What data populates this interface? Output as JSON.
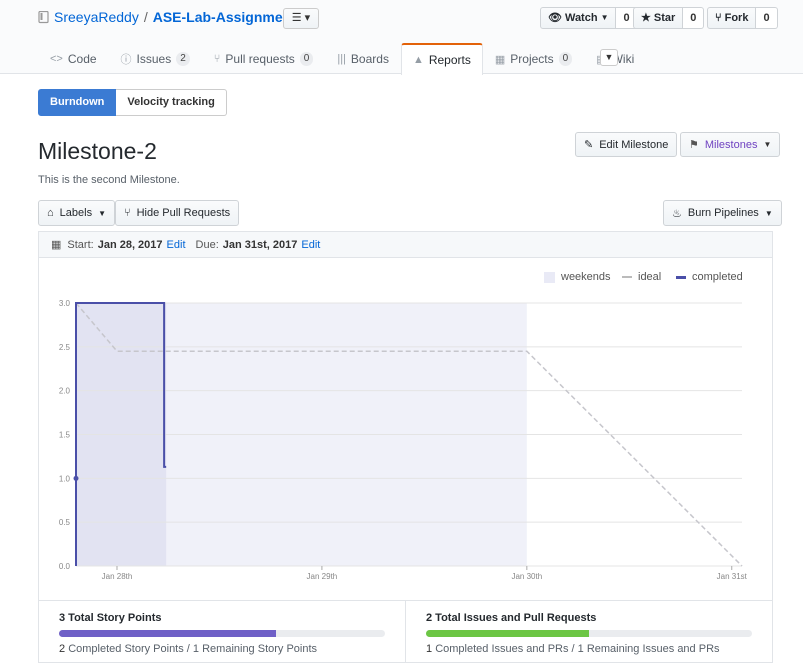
{
  "repo": {
    "owner": "SreeyaReddy",
    "separator": "/",
    "name": "ASE-Lab-Assignments"
  },
  "social": {
    "watch": {
      "label": "Watch",
      "count": "0"
    },
    "star": {
      "label": "Star",
      "count": "0"
    },
    "fork": {
      "label": "Fork",
      "count": "0"
    }
  },
  "tabs": [
    {
      "label": "Code",
      "count": ""
    },
    {
      "label": "Issues",
      "count": "2"
    },
    {
      "label": "Pull requests",
      "count": "0"
    },
    {
      "label": "Boards",
      "count": ""
    },
    {
      "label": "Reports",
      "count": ""
    },
    {
      "label": "Projects",
      "count": "0"
    },
    {
      "label": "Wiki",
      "count": ""
    }
  ],
  "report_tabs": {
    "burndown": "Burndown",
    "velocity": "Velocity tracking"
  },
  "milestone": {
    "title": "Milestone-2",
    "description": "This is the second Milestone."
  },
  "buttons": {
    "edit_milestone": "Edit Milestone",
    "milestones": "Milestones",
    "labels": "Labels",
    "hide_prs": "Hide Pull Requests",
    "burn_pipelines": "Burn Pipelines"
  },
  "dates": {
    "start_label": "Start:",
    "start": "Jan 28, 2017",
    "edit": "Edit",
    "due_label": "Due:",
    "due": "Jan 31st, 2017"
  },
  "chart_data": {
    "type": "line",
    "legend": [
      "weekends",
      "ideal",
      "completed"
    ],
    "legend_position": "top-right",
    "x_ticks": [
      "Jan 28th",
      "Jan 29th",
      "Jan 30th",
      "Jan 31st"
    ],
    "y_ticks": [
      "0.0",
      "0.5",
      "1.0",
      "1.5",
      "2.0",
      "2.5",
      "3.0"
    ],
    "ylim": [
      0,
      3
    ],
    "xlim": [
      -0.2,
      3.05
    ],
    "grid": true,
    "weekend_range": [
      -0.2,
      2.0
    ],
    "ideal": {
      "name": "ideal",
      "x": [
        -0.2,
        0.0,
        2.0,
        3.05
      ],
      "y": [
        3.0,
        2.45,
        2.45,
        0.0
      ]
    },
    "completed": {
      "name": "completed",
      "x": [
        -0.2,
        -0.2,
        0.23,
        0.23,
        0.24
      ],
      "y": [
        0.0,
        3.0,
        3.0,
        1.13,
        1.13
      ]
    },
    "completed_marker": {
      "x": -0.2,
      "y": 1.0
    },
    "highlight_range": [
      -0.2,
      0.24
    ]
  },
  "stats": {
    "points": {
      "title": "3 Total Story Points",
      "done": "2",
      "done_text": "Completed Story Points",
      "sep": " / ",
      "remaining": "1 Remaining Story Points",
      "fraction": 0.667,
      "color": "#6f60c7"
    },
    "issues": {
      "title": "2 Total Issues and Pull Requests",
      "done": "1",
      "done_text": "Completed Issues and PRs",
      "sep": " / ",
      "remaining": "1 Remaining Issues and PRs",
      "fraction": 0.5,
      "color": "#6cc644"
    }
  }
}
